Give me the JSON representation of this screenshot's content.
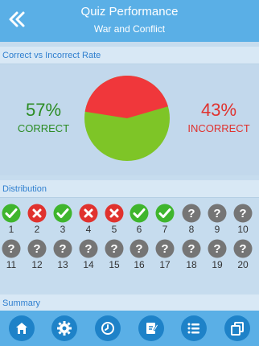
{
  "header": {
    "title": "Quiz Performance",
    "subtitle": "War and Conflict",
    "back_icon": "double-chevron-left-icon"
  },
  "sections": {
    "rate_label": "Correct vs Incorrect Rate",
    "distribution_label": "Distribution",
    "summary_label": "Summary"
  },
  "rate": {
    "correct_pct": "57%",
    "correct_label": "CORRECT",
    "incorrect_pct": "43%",
    "incorrect_label": "INCORRECT",
    "correct_fraction": 0.57,
    "colors": {
      "correct": "#7ec527",
      "incorrect": "#f0373b"
    }
  },
  "distribution": [
    {
      "n": "1",
      "status": "correct"
    },
    {
      "n": "2",
      "status": "incorrect"
    },
    {
      "n": "3",
      "status": "correct"
    },
    {
      "n": "4",
      "status": "incorrect"
    },
    {
      "n": "5",
      "status": "incorrect"
    },
    {
      "n": "6",
      "status": "correct"
    },
    {
      "n": "7",
      "status": "correct"
    },
    {
      "n": "8",
      "status": "unanswered"
    },
    {
      "n": "9",
      "status": "unanswered"
    },
    {
      "n": "10",
      "status": "unanswered"
    },
    {
      "n": "11",
      "status": "unanswered"
    },
    {
      "n": "12",
      "status": "unanswered"
    },
    {
      "n": "13",
      "status": "unanswered"
    },
    {
      "n": "14",
      "status": "unanswered"
    },
    {
      "n": "15",
      "status": "unanswered"
    },
    {
      "n": "16",
      "status": "unanswered"
    },
    {
      "n": "17",
      "status": "unanswered"
    },
    {
      "n": "18",
      "status": "unanswered"
    },
    {
      "n": "19",
      "status": "unanswered"
    },
    {
      "n": "20",
      "status": "unanswered"
    }
  ],
  "bottom_tabs": [
    {
      "icon": "home-icon"
    },
    {
      "icon": "gear-icon"
    },
    {
      "icon": "clock-icon"
    },
    {
      "icon": "edit-note-icon"
    },
    {
      "icon": "list-icon"
    },
    {
      "icon": "copy-icon"
    }
  ]
}
